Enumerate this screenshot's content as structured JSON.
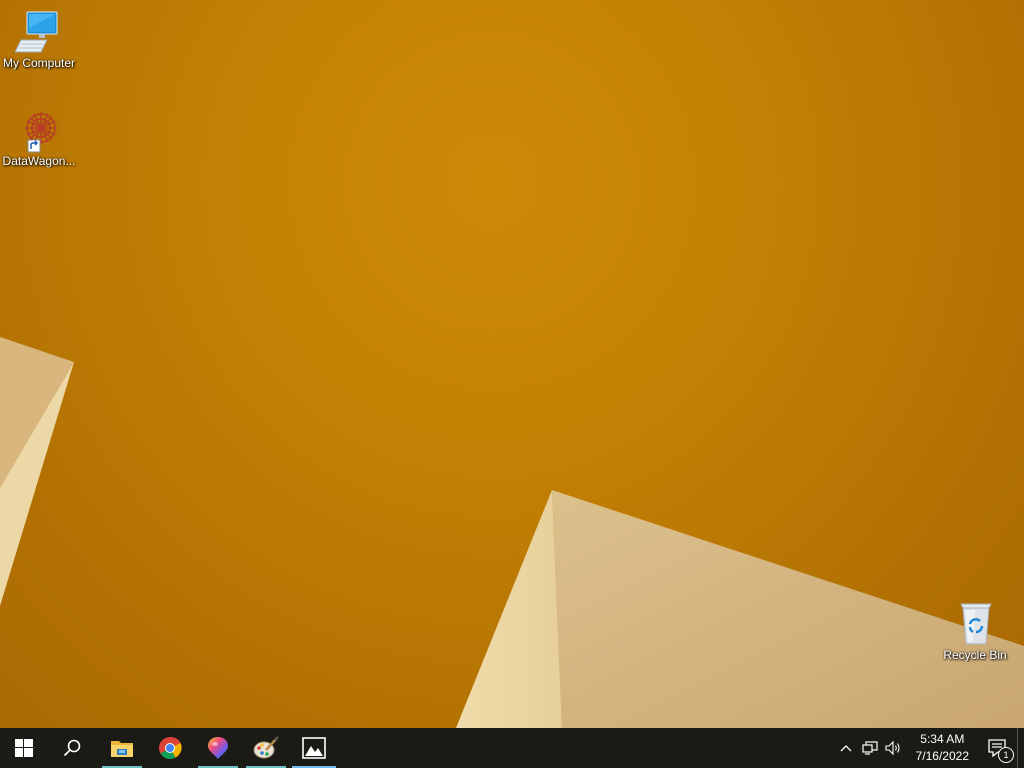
{
  "desktop": {
    "icons": [
      {
        "label": "My Computer",
        "icon": "computer-icon"
      },
      {
        "label": "DataWagon...",
        "icon": "datawagon-app-icon"
      },
      {
        "label": "Recycle Bin",
        "icon": "recycle-bin-icon"
      }
    ]
  },
  "taskbar": {
    "items": [
      {
        "icon": "windows-start-icon",
        "state": "normal"
      },
      {
        "icon": "search-icon",
        "state": "normal"
      },
      {
        "icon": "file-explorer-icon",
        "state": "open"
      },
      {
        "icon": "chrome-icon",
        "state": "pinned"
      },
      {
        "icon": "paint-3d-icon",
        "state": "open"
      },
      {
        "icon": "paint-icon",
        "state": "open"
      },
      {
        "icon": "photos-icon",
        "state": "open"
      }
    ],
    "tray": {
      "icons": [
        "chevron-up-icon",
        "network-icon",
        "volume-icon"
      ],
      "time": "5:34 AM",
      "date": "7/16/2022",
      "notification_count": "1"
    }
  },
  "colors": {
    "wallpaper": "#c38105",
    "taskbar": "#1c1a15",
    "active_indicator": "#76b9ed"
  }
}
